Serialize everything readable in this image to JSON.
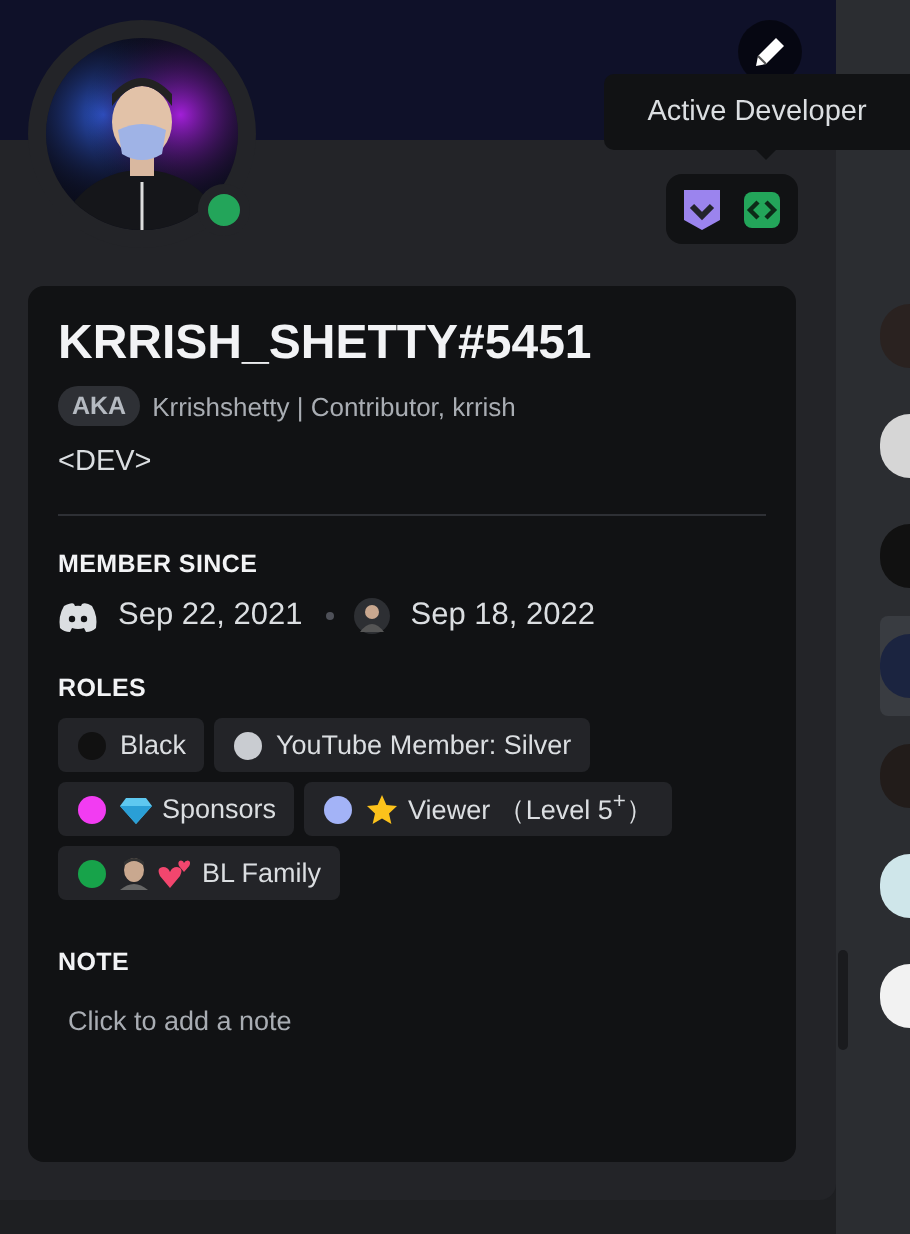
{
  "profile": {
    "username": "KRRISH_SHETTY#5451",
    "aka_label": "AKA",
    "aka": "Krrishshetty | Contributor, krrish",
    "bio": "<DEV>",
    "online": true
  },
  "tooltip": "Active Developer",
  "member_since": {
    "title": "MEMBER SINCE",
    "discord_date": "Sep 22, 2021",
    "server_date": "Sep 18, 2022"
  },
  "roles": {
    "title": "ROLES",
    "items": [
      {
        "name": "Black",
        "color": "#111111",
        "kind": "plain"
      },
      {
        "name": "YouTube Member: Silver",
        "color": "#c9ccd1",
        "kind": "plain"
      },
      {
        "name": "Sponsors",
        "color": "#f23cf2",
        "kind": "gem"
      },
      {
        "name": "Viewer （Level 5$^{+}$）",
        "color": "#a3b3f7",
        "kind": "star"
      },
      {
        "name": "BL Family",
        "color": "#17a34a",
        "kind": "avatar-heart"
      }
    ]
  },
  "note": {
    "title": "NOTE",
    "placeholder": "Click to add a note"
  },
  "member_list": {
    "items": [
      {
        "selected": false
      },
      {
        "selected": false
      },
      {
        "selected": false
      },
      {
        "selected": true
      },
      {
        "selected": false
      },
      {
        "selected": false
      },
      {
        "selected": false
      }
    ]
  }
}
